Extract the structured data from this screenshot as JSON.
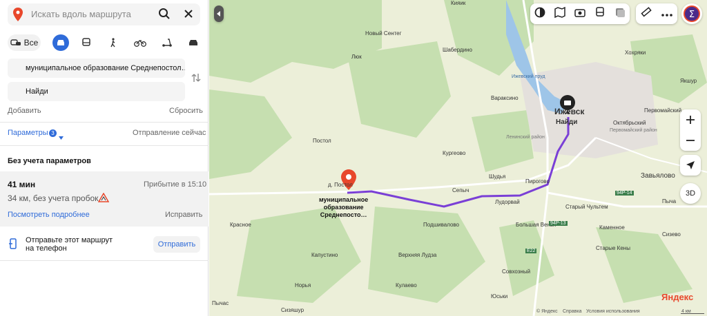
{
  "search": {
    "placeholder": "Искать вдоль маршрута"
  },
  "modes": {
    "all_label": "Все"
  },
  "route": {
    "from": "муниципальное образование Среднепостол…",
    "to": "Найди",
    "add": "Добавить",
    "reset": "Сбросить",
    "params_label": "Параметры",
    "params_count": "3",
    "departure": "Отправление сейчас"
  },
  "result": {
    "section_title": "Без учета параметров",
    "duration": "41 мин",
    "arrival": "Прибытие в 15:10",
    "distance": "34 км, без учета пробок",
    "details_link": "Посмотреть подробнее",
    "fix": "Исправить"
  },
  "send": {
    "text_line1": "Отправьте этот маршрут",
    "text_line2": "на телефон",
    "button": "Отправить"
  },
  "map": {
    "places": [
      {
        "name": "Кияик"
      },
      {
        "name": "Новый Сентег"
      },
      {
        "name": "Люк"
      },
      {
        "name": "Шабердино"
      },
      {
        "name": "Ижевский пруд"
      },
      {
        "name": "Вараксино"
      },
      {
        "name": "Ижевск"
      },
      {
        "name": "Найди"
      },
      {
        "name": "Первомайский"
      },
      {
        "name": "Октябрьский"
      },
      {
        "name": "Хохряки"
      },
      {
        "name": "Якшур"
      },
      {
        "name": "Первомайский район"
      },
      {
        "name": "Ленинский район"
      },
      {
        "name": "Постол"
      },
      {
        "name": "Кургеово"
      },
      {
        "name": "д. Постол"
      },
      {
        "name": "Шудья"
      },
      {
        "name": "Сепыч"
      },
      {
        "name": "Пироговo"
      },
      {
        "name": "Завьялово"
      },
      {
        "name": "Лудорвай"
      },
      {
        "name": "Старый Чультем"
      },
      {
        "name": "Красное"
      },
      {
        "name": "Подшивалово"
      },
      {
        "name": "Большая Венья"
      },
      {
        "name": "Каменное"
      },
      {
        "name": "Сизево"
      },
      {
        "name": "Старые Кены"
      },
      {
        "name": "Капустино"
      },
      {
        "name": "Верхняя Лудза"
      },
      {
        "name": "Норья"
      },
      {
        "name": "Совхозный"
      },
      {
        "name": "Кулаево"
      },
      {
        "name": "Юськи"
      },
      {
        "name": "Пычас"
      },
      {
        "name": "Сизяшур"
      },
      {
        "name": "Пыча"
      }
    ],
    "start_label_line1": "муниципальное",
    "start_label_line2": "образование",
    "start_label_line3": "Среднепосто…",
    "road_labels": [
      "Р-14",
      "94Р-13",
      "94Р-14",
      "Е22"
    ],
    "scale": "4 км",
    "brand": "Яндекс",
    "copyright": "© Яндекс",
    "help": "Справка",
    "terms": "Условия использования",
    "button_3d": "3D"
  },
  "colors": {
    "accent": "#2f6bd9",
    "route": "#7a3fd6",
    "start_pin": "#e8472b",
    "forest": "#c6dfb0",
    "water": "#9ec5e8"
  }
}
